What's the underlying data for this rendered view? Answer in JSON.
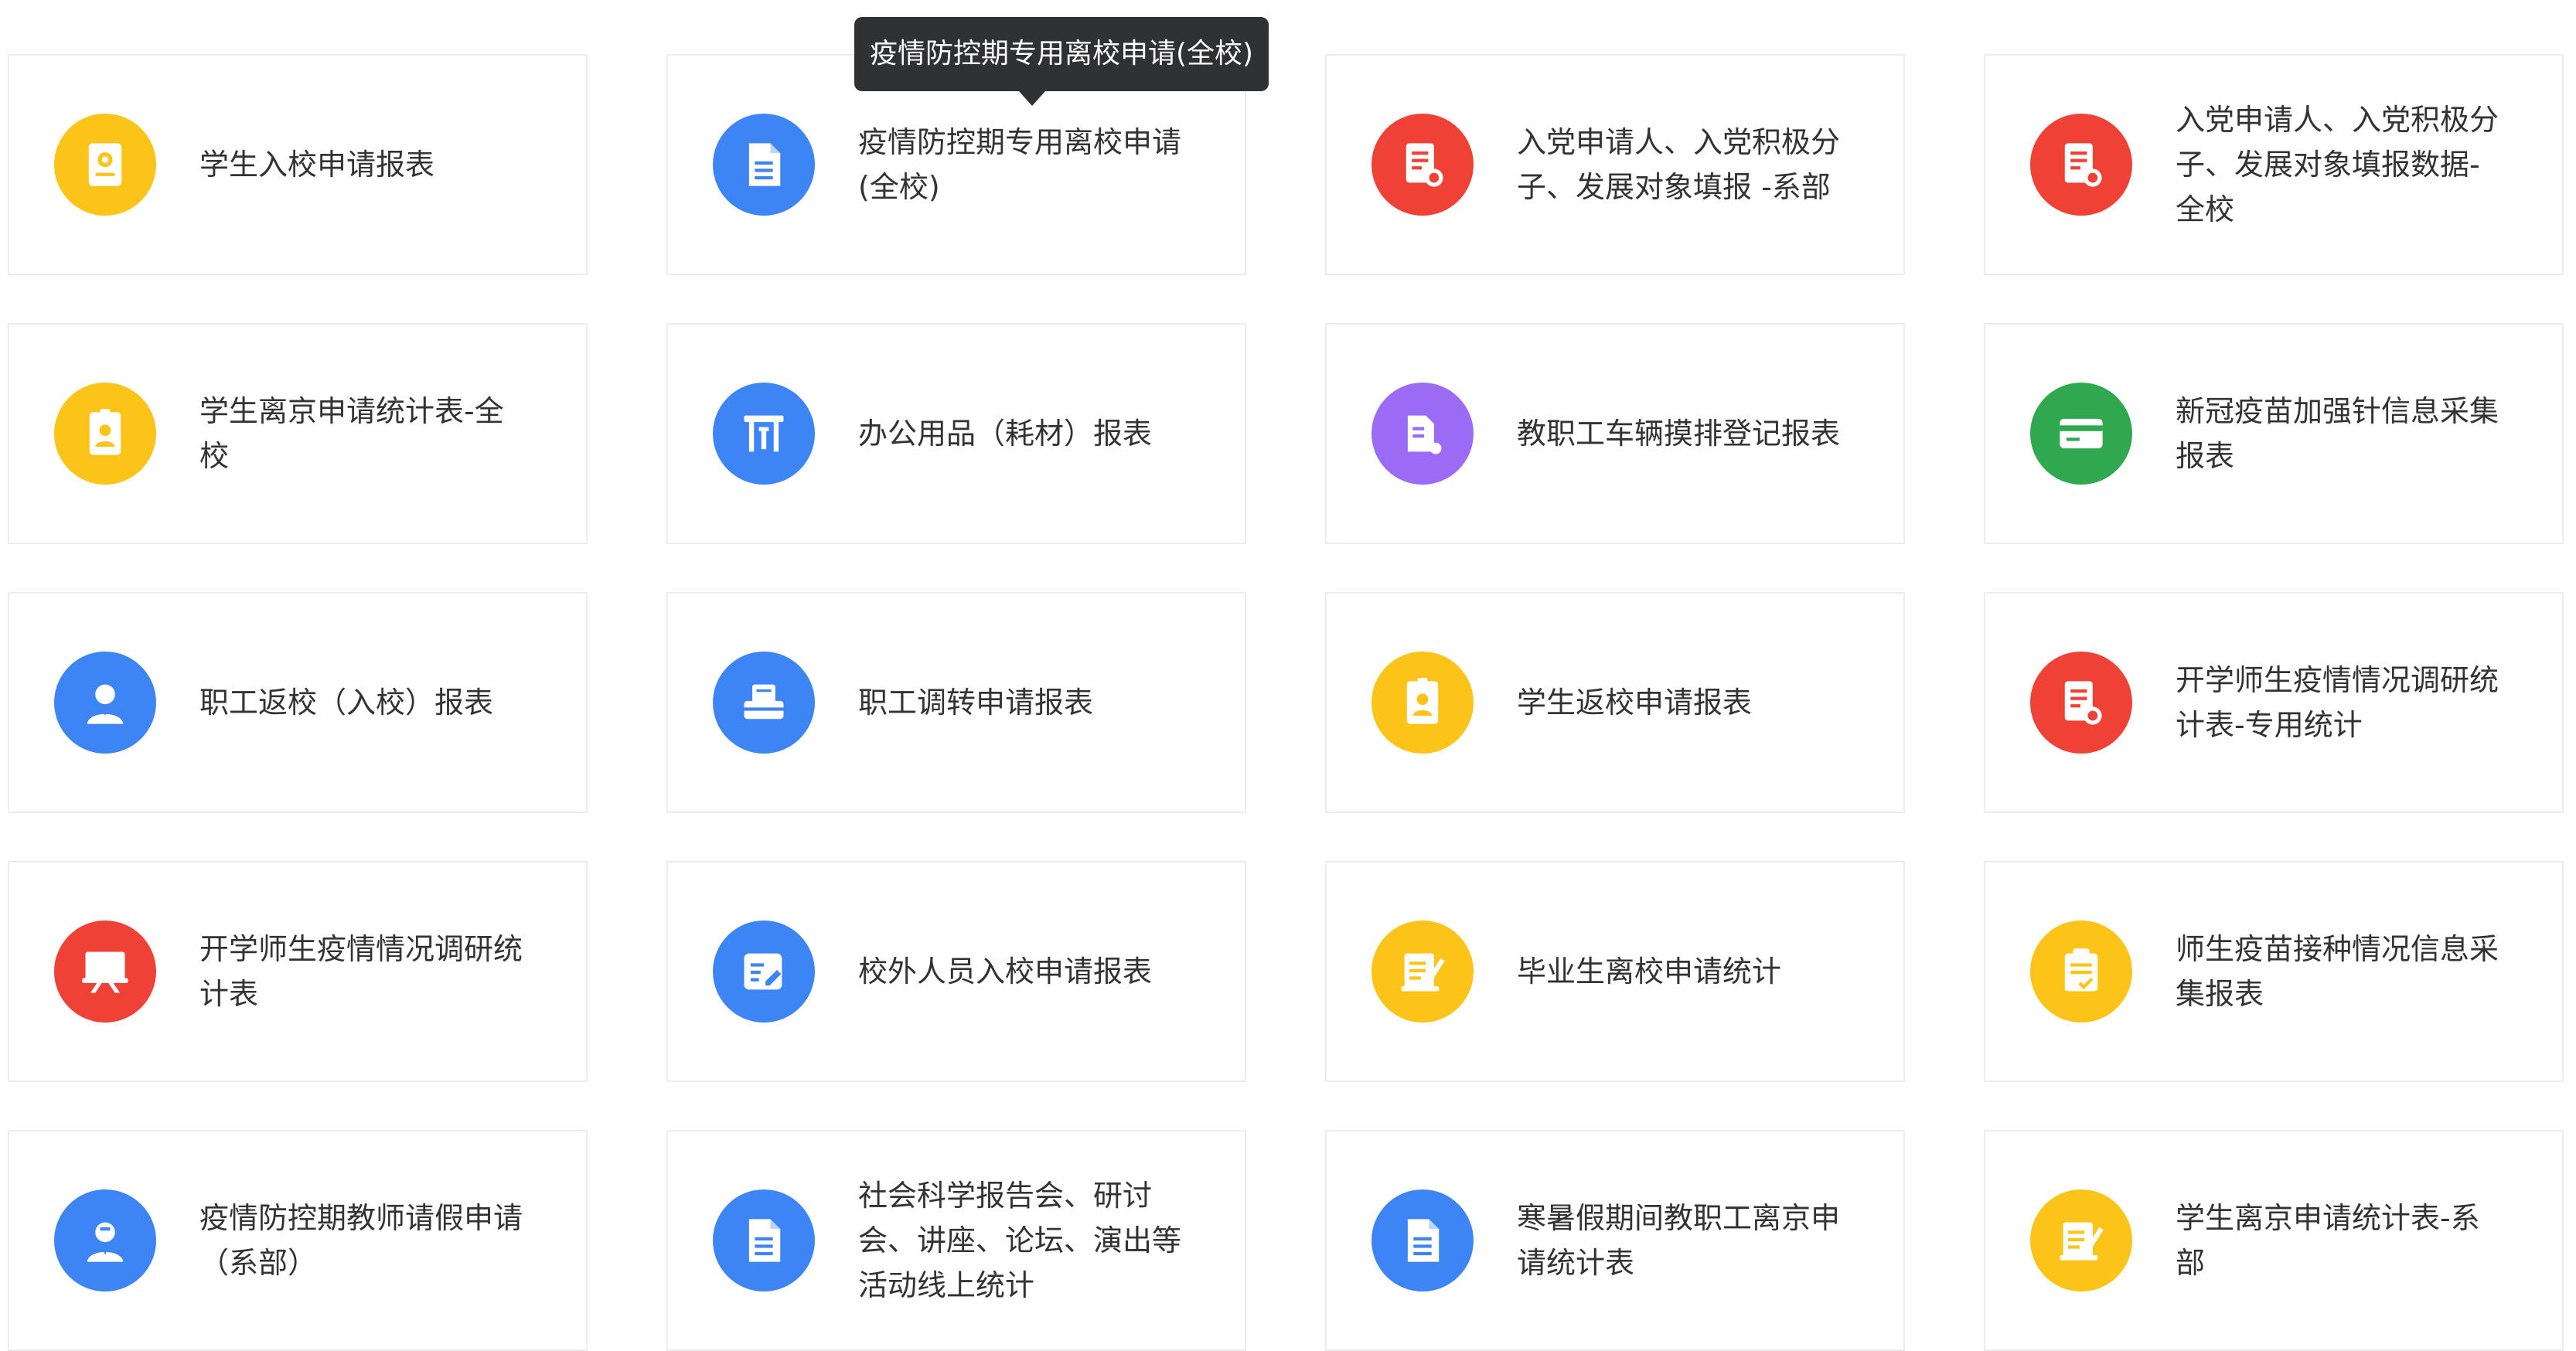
{
  "tooltip": {
    "text": "疫情防控期专用离校申请(全校)"
  },
  "colors": {
    "yellow": "#fcc419",
    "blue": "#3d84f5",
    "red": "#ef4136",
    "purple": "#9b6bf6",
    "green": "#2fa84f"
  },
  "cards": [
    {
      "label": "学生入校申请报表",
      "icon": "certificate-icon",
      "color": "#fcc419"
    },
    {
      "label": "疫情防控期专用离校申请(全校)",
      "icon": "document-icon",
      "color": "#3d84f5"
    },
    {
      "label": "入党申请人、入党积极分子、发展对象填报 -系部",
      "icon": "form-badge-icon",
      "color": "#ef4136"
    },
    {
      "label": "入党申请人、入党积极分子、发展对象填报数据-全校",
      "icon": "form-badge-icon",
      "color": "#ef4136"
    },
    {
      "label": "学生离京申请统计表-全校",
      "icon": "id-card-icon",
      "color": "#fcc419"
    },
    {
      "label": "办公用品（耗材）报表",
      "icon": "office-supplies-icon",
      "color": "#3d84f5"
    },
    {
      "label": "教职工车辆摸排登记报表",
      "icon": "vehicle-doc-icon",
      "color": "#9b6bf6"
    },
    {
      "label": "新冠疫苗加强针信息采集报表",
      "icon": "card-icon",
      "color": "#2fa84f"
    },
    {
      "label": "职工返校（入校）报表",
      "icon": "staff-icon",
      "color": "#3d84f5"
    },
    {
      "label": "职工调转申请报表",
      "icon": "transfer-icon",
      "color": "#3d84f5"
    },
    {
      "label": "学生返校申请报表",
      "icon": "id-card-icon",
      "color": "#fcc419"
    },
    {
      "label": "开学师生疫情情况调研统计表-专用统计",
      "icon": "form-badge-icon",
      "color": "#ef4136"
    },
    {
      "label": "开学师生疫情情况调研统计表",
      "icon": "presentation-icon",
      "color": "#ef4136"
    },
    {
      "label": "校外人员入校申请报表",
      "icon": "edit-form-icon",
      "color": "#3d84f5"
    },
    {
      "label": "毕业生离校申请统计",
      "icon": "notes-edit-icon",
      "color": "#fcc419"
    },
    {
      "label": "师生疫苗接种情况信息采集报表",
      "icon": "clipboard-check-icon",
      "color": "#fcc419"
    },
    {
      "label": "疫情防控期教师请假申请（系部）",
      "icon": "teacher-icon",
      "color": "#3d84f5"
    },
    {
      "label": "社会科学报告会、研讨会、讲座、论坛、演出等活动线上统计",
      "icon": "document-icon",
      "color": "#3d84f5"
    },
    {
      "label": "寒暑假期间教职工离京申请统计表",
      "icon": "document-icon",
      "color": "#3d84f5"
    },
    {
      "label": "学生离京申请统计表-系部",
      "icon": "notes-edit-icon",
      "color": "#fcc419"
    }
  ]
}
